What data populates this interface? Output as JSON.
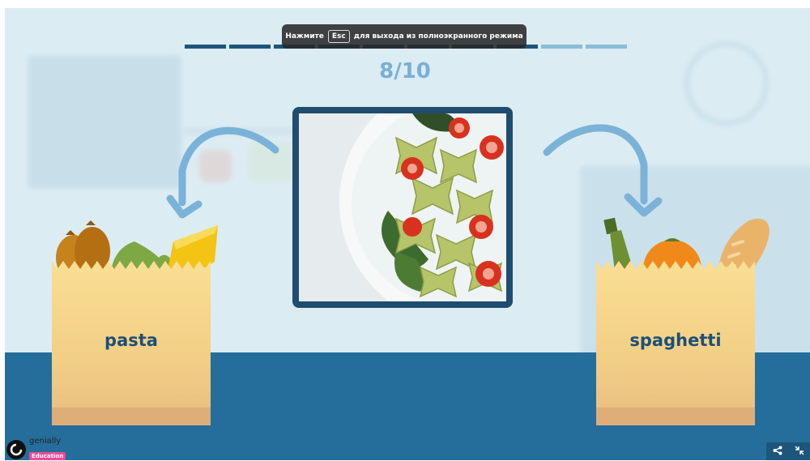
{
  "toast": {
    "before": "Нажмите",
    "key": "Esc",
    "after": "для выхода из полноэкранного режима"
  },
  "progress": {
    "current": 8,
    "total": 10,
    "label": "8/10"
  },
  "answers": {
    "left_label": "pasta",
    "right_label": "spaghetti"
  },
  "branding": {
    "name": "genially",
    "badge": "Education"
  },
  "icons": {
    "share": "share-icon",
    "exit_fullscreen": "exit-fullscreen-icon"
  },
  "colors": {
    "navy": "#1c4f78",
    "floor": "#256e9b",
    "arrow": "#7bb3d8",
    "bag": "#f6d68c",
    "progress_done": "#1d557b",
    "progress_todo": "#8cbcd8"
  }
}
